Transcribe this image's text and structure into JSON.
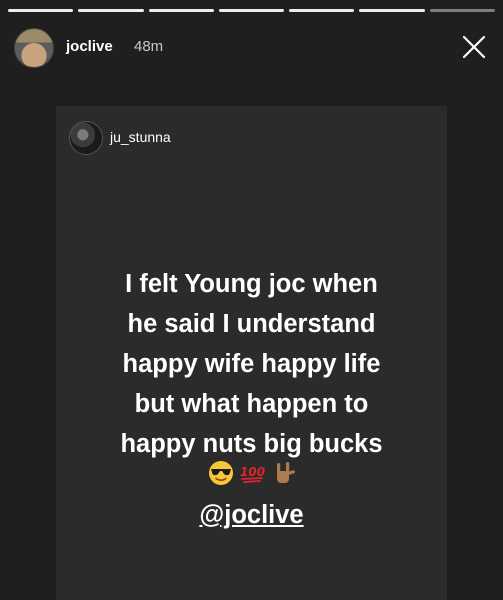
{
  "story": {
    "progress": {
      "segments": 7,
      "completed": 6
    },
    "header": {
      "username": "joclive",
      "time": "48m"
    },
    "shared_post": {
      "username": "ju_stunna",
      "text_lines": [
        "I felt Young joc when",
        "he said I understand",
        "happy wife happy life",
        "but what happen to",
        "happy nuts big bucks"
      ],
      "emojis": [
        "sunglasses-face-icon",
        "hundred-points-icon",
        "love-you-gesture-icon"
      ],
      "mention": "@joclive"
    }
  },
  "colors": {
    "background": "#1f1f1f",
    "card": "#2b2b2b",
    "text": "#ffffff"
  }
}
